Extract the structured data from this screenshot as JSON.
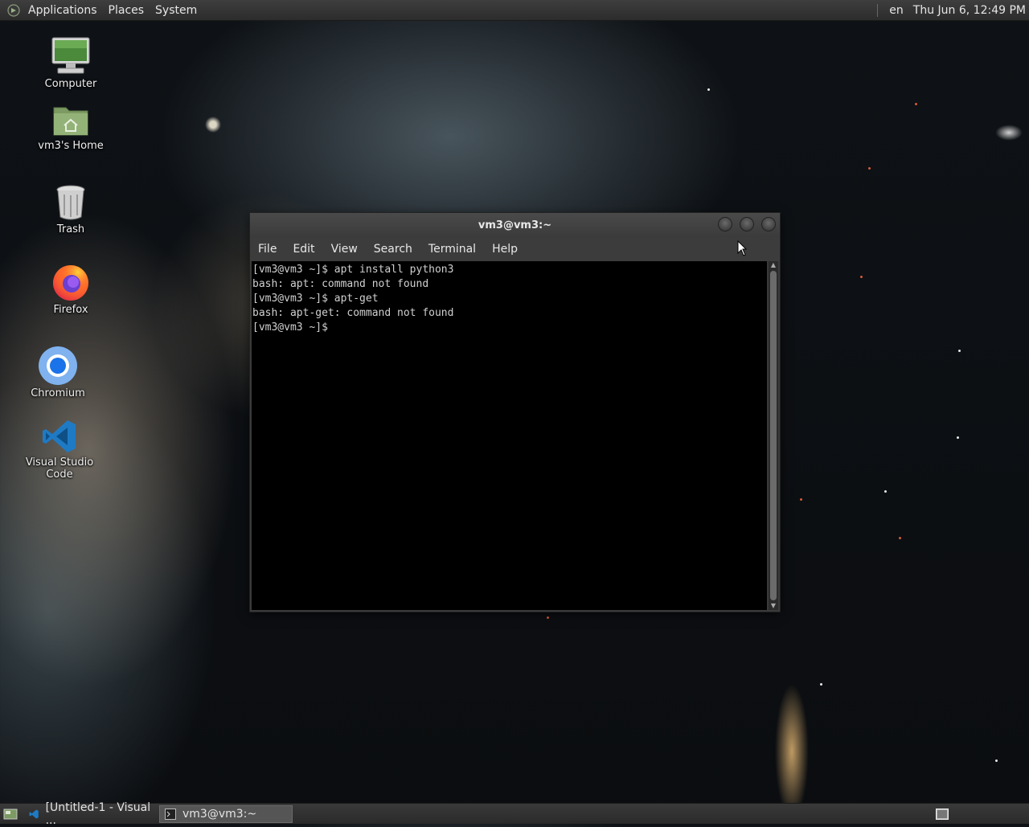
{
  "top_panel": {
    "menus": [
      "Applications",
      "Places",
      "System"
    ],
    "language": "en",
    "clock": "Thu Jun  6, 12:49 PM"
  },
  "desktop_icons": [
    {
      "label": "Computer",
      "icon": "computer-icon"
    },
    {
      "label": "vm3's Home",
      "icon": "home-folder-icon"
    },
    {
      "label": "Trash",
      "icon": "trash-icon"
    },
    {
      "label": "Firefox",
      "icon": "firefox-icon"
    },
    {
      "label": "Chromium",
      "icon": "chromium-icon"
    },
    {
      "label": "Visual Studio Code",
      "icon": "vscode-icon"
    }
  ],
  "terminal": {
    "title": "vm3@vm3:~",
    "menu": [
      "File",
      "Edit",
      "View",
      "Search",
      "Terminal",
      "Help"
    ],
    "lines": [
      "[vm3@vm3 ~]$ apt install python3",
      "bash: apt: command not found",
      "[vm3@vm3 ~]$ apt-get",
      "bash: apt-get: command not found",
      "[vm3@vm3 ~]$"
    ]
  },
  "taskbar": {
    "tasks": [
      {
        "label": "[Untitled-1 - Visual ...",
        "icon": "vscode-icon",
        "active": false
      },
      {
        "label": "vm3@vm3:~",
        "icon": "terminal-icon",
        "active": true
      }
    ]
  }
}
